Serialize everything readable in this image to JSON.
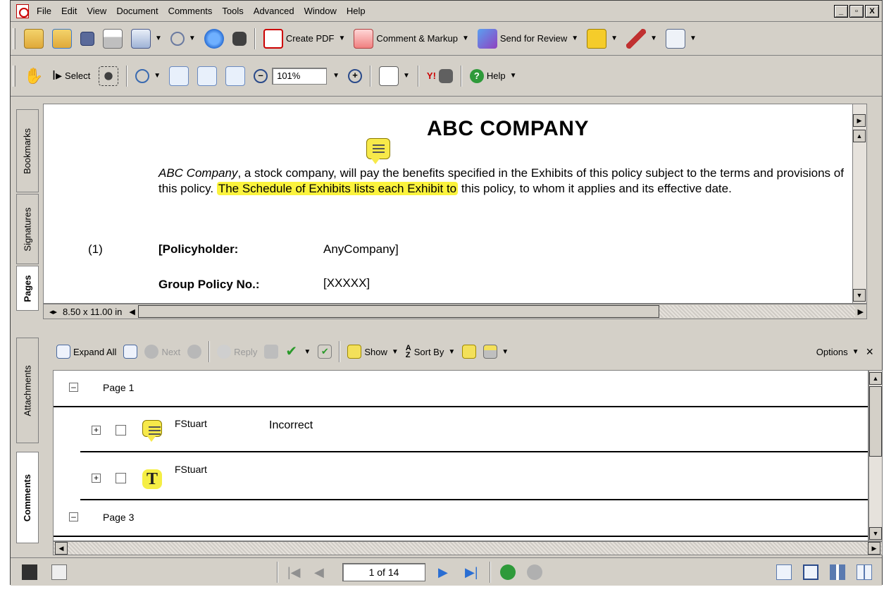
{
  "colors": {
    "chrome": "#d4d0c8",
    "highlight": "#fbf33d",
    "note_yellow": "#f7e94a",
    "pdf_red": "#cc0000",
    "link_blue": "#2a6ed3"
  },
  "menubar": {
    "app_icon": "pdf-icon",
    "items": [
      "File",
      "Edit",
      "View",
      "Document",
      "Comments",
      "Tools",
      "Advanced",
      "Window",
      "Help"
    ],
    "window_controls": [
      "_",
      "▫",
      "X"
    ]
  },
  "toolbar1": {
    "icons": [
      "open-folder-icon",
      "share-folder-icon",
      "save-icon",
      "print-icon",
      "organizer-icon",
      "attach-icon",
      "email-icon",
      "search-binoculars-icon"
    ],
    "create_pdf": "Create PDF",
    "comment_markup": "Comment & Markup",
    "send_review": "Send for Review",
    "trailing_icons": [
      "lock-icon",
      "sign-pen-icon",
      "forms-icon"
    ]
  },
  "toolbar2": {
    "hand_icon": "hand-icon",
    "select_label": "Select",
    "snapshot_icon": "camera-icon",
    "zoom_in_tool_icon": "zoom-magnifier-icon",
    "fit_icons": [
      "actual-size-icon",
      "fit-page-icon",
      "fit-width-icon"
    ],
    "zoom_out_icon": "minus-circle-icon",
    "zoom_value": "101%",
    "zoom_in_icon": "plus-circle-icon",
    "pages_icon": "pages-icon",
    "yahoo_label": "Y!",
    "help_label": "Help"
  },
  "nav_tabs": {
    "bookmarks": "Bookmarks",
    "signatures": "Signatures",
    "pages": "Pages"
  },
  "document": {
    "title": "ABC COMPANY",
    "para_italic": "ABC Company",
    "para_pre": ", a stock company, will pay the benefits specified in the Exhibits of this policy subject to the terms and provisions of this policy. ",
    "para_highlight": "The Schedule of Exhibits lists each Exhibit to",
    "para_post": " this policy, to whom it applies and its effective date.",
    "item_number": "(1)",
    "policyholder_label": "[Policyholder:",
    "policyholder_value": "AnyCompany]",
    "group_policy_label": "Group Policy No.:",
    "group_policy_value": "[XXXXX]",
    "page_size": "8.50 x 11.00 in"
  },
  "comments_tabs": {
    "attachments": "Attachments",
    "comments": "Comments"
  },
  "comments_toolbar": {
    "expand_all": "Expand All",
    "next": "Next",
    "reply": "Reply",
    "show": "Show",
    "sort_by": "Sort By",
    "options": "Options",
    "close": "×"
  },
  "comments_list": {
    "page1_label": "Page 1",
    "items": [
      {
        "author": "FStuart",
        "text": "Incorrect",
        "type_icon": "note-icon"
      },
      {
        "author": "FStuart",
        "text": "",
        "type_icon": "text-highlight-icon"
      }
    ],
    "page3_label": "Page 3"
  },
  "statusbar": {
    "page_indicator": "1 of 14",
    "nav_icons": [
      "first-page-icon",
      "prev-page-icon",
      "next-page-icon",
      "last-page-icon",
      "back-icon",
      "forward-icon"
    ],
    "layout_icons": [
      "single-page-icon",
      "continuous-icon",
      "facing-icon",
      "continuous-facing-icon"
    ]
  }
}
